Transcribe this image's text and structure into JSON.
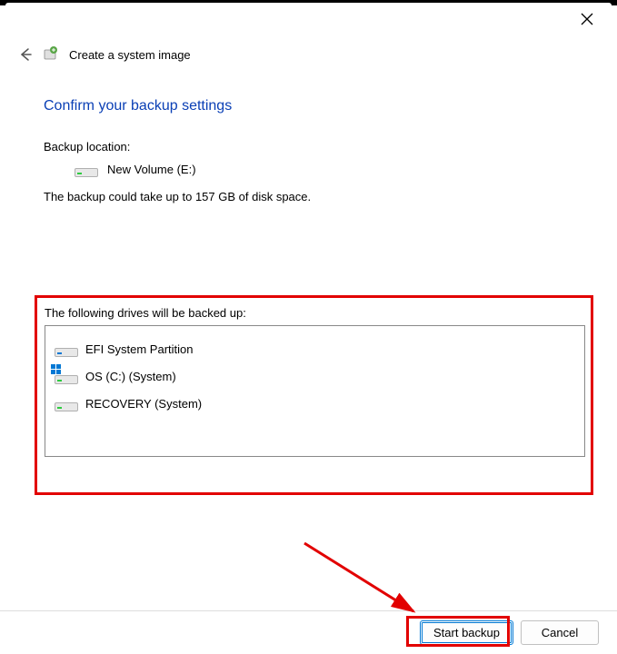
{
  "header": {
    "title": "Create a system image"
  },
  "page": {
    "title": "Confirm your backup settings",
    "backup_location_label": "Backup location:",
    "backup_location_value": "New Volume (E:)",
    "space_note": "The backup could take up to 157 GB of disk space."
  },
  "drives_section": {
    "label": "The following drives will be backed up:",
    "items": [
      {
        "name": "EFI System Partition",
        "led": "blue",
        "win_logo": false
      },
      {
        "name": "OS (C:) (System)",
        "led": "green",
        "win_logo": true
      },
      {
        "name": "RECOVERY (System)",
        "led": "green",
        "win_logo": false
      }
    ]
  },
  "footer": {
    "start": "Start backup",
    "cancel": "Cancel"
  }
}
